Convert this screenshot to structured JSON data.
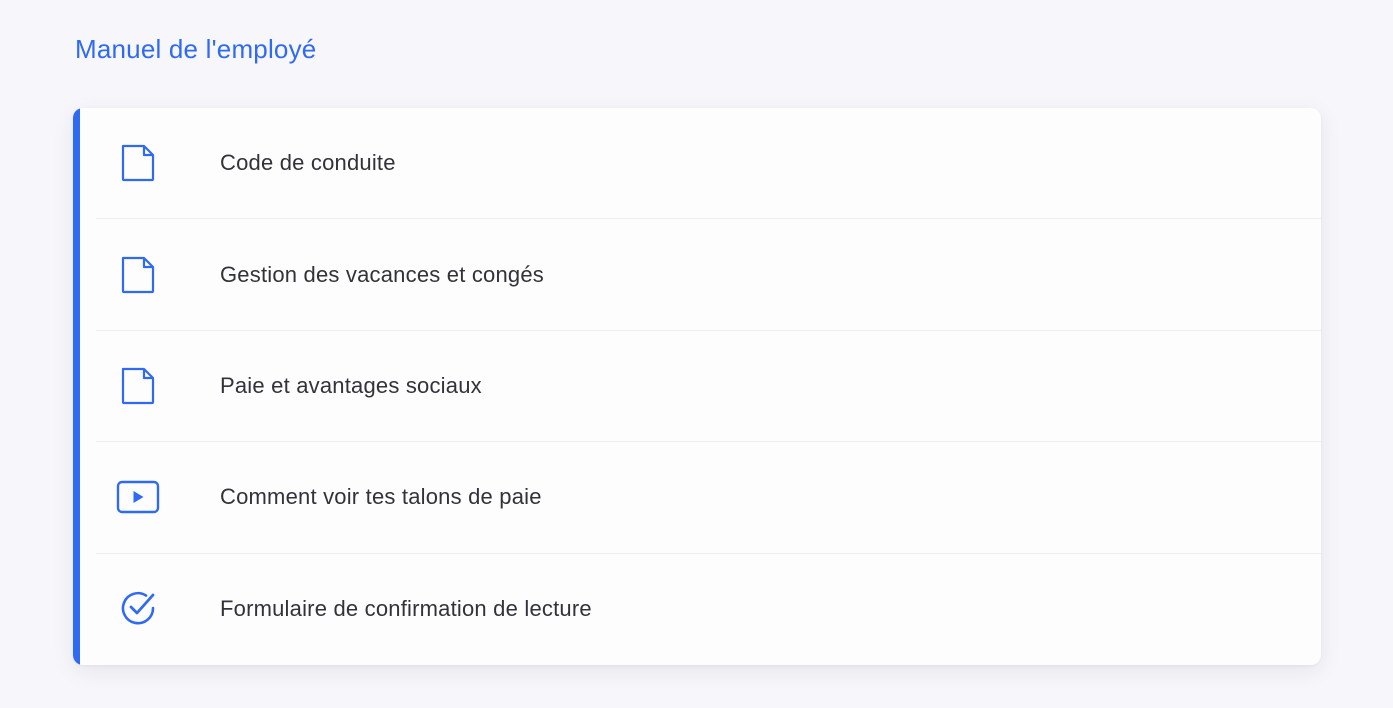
{
  "header": {
    "title": "Manuel de l'employé"
  },
  "theme": {
    "accent": "#2f6bf2",
    "text": "#33323a",
    "background": "#f7f6fa",
    "card": "#fdfdfe"
  },
  "items": [
    {
      "label": "Code de conduite",
      "icon": "document-icon"
    },
    {
      "label": "Gestion des vacances et congés",
      "icon": "document-icon"
    },
    {
      "label": "Paie et avantages sociaux",
      "icon": "document-icon"
    },
    {
      "label": "Comment voir tes talons de paie",
      "icon": "video-play-icon"
    },
    {
      "label": "Formulaire de confirmation de lecture",
      "icon": "check-circle-icon"
    }
  ]
}
